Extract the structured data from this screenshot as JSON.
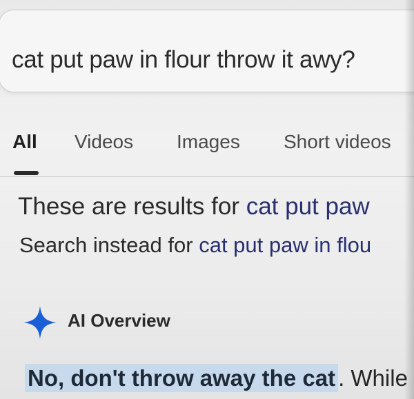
{
  "search": {
    "query": "cat put paw in flour throw it awy?"
  },
  "tabs": [
    {
      "label": "All",
      "active": true
    },
    {
      "label": "Videos",
      "active": false
    },
    {
      "label": "Images",
      "active": false
    },
    {
      "label": "Short videos",
      "active": false
    }
  ],
  "correction": {
    "prefix": "These are results for ",
    "corrected_query": "cat put paw",
    "instead_prefix": "Search instead for ",
    "original_query": "cat put paw in flou"
  },
  "ai_overview": {
    "label": "AI Overview",
    "icon": "sparkle-icon",
    "answer_highlight": "No, don't throw away the cat",
    "answer_rest": ". While"
  },
  "colors": {
    "link": "#2a2f6e",
    "sparkle": "#1a5fd6",
    "highlight": "#c7d9ec"
  }
}
